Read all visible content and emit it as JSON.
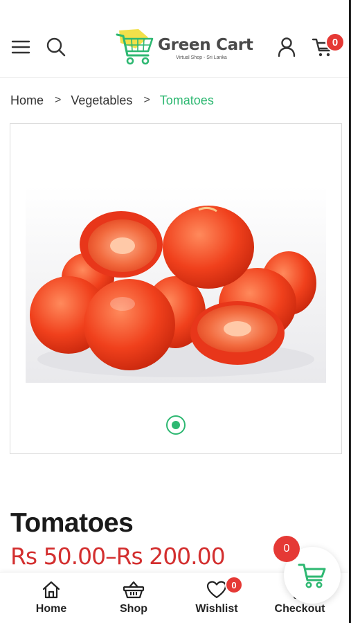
{
  "header": {
    "logo": {
      "name": "Green Cart",
      "tagline": "Virtual Shop - Sri Lanka"
    },
    "icons": {
      "menu": "menu-icon",
      "search": "search-icon",
      "account": "user-icon",
      "cart": "cart-icon"
    },
    "cart_count": "0"
  },
  "breadcrumb": {
    "items": [
      "Home",
      "Vegetables",
      "Tomatoes"
    ],
    "separator": ">"
  },
  "gallery": {
    "image_alt": "Tomatoes",
    "slide_count": 1,
    "active_slide": 1
  },
  "product": {
    "title": "Tomatoes",
    "price_range": "Rs 50.00–Rs 200.00"
  },
  "bottom_nav": {
    "items": [
      {
        "label": "Home",
        "icon": "home-icon"
      },
      {
        "label": "Shop",
        "icon": "basket-icon"
      },
      {
        "label": "Wishlist",
        "icon": "heart-icon"
      },
      {
        "label": "Checkout",
        "icon": "checkout-icon"
      }
    ],
    "wishlist_count": "0"
  },
  "floating_cart": {
    "count": "0",
    "icon": "cart-icon"
  },
  "colors": {
    "accent_green": "#2eb872",
    "price_red": "#d32f2f",
    "badge_red": "#e53935",
    "logo_yellow": "#f2e04a"
  }
}
